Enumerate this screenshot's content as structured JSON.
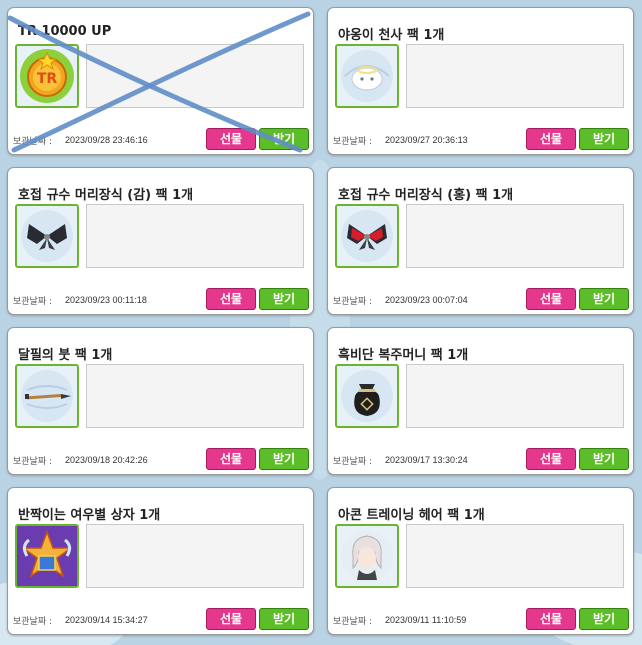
{
  "labels": {
    "storage_date": "보관날짜 :",
    "gift_button": "선물",
    "receive_button": "받기"
  },
  "colors": {
    "gift": "#e4388e",
    "receive": "#5bbd27",
    "frame": "#6bb52e",
    "cross_mark": "#5f8dc6"
  },
  "items": [
    {
      "title": "TR 10000 UP",
      "date": "2023/09/28 23:46:16",
      "icon": "tr-coin-icon",
      "crossed_out": true
    },
    {
      "title": "야옹이 천사 팩 1개",
      "date": "2023/09/27 20:36:13",
      "icon": "angel-cat-pack-icon",
      "crossed_out": false
    },
    {
      "title": "호접 규수 머리장식 (감) 팩 1개",
      "date": "2023/09/23 00:11:18",
      "icon": "black-butterfly-icon",
      "crossed_out": false
    },
    {
      "title": "호접 규수 머리장식 (홍) 팩 1개",
      "date": "2023/09/23 00:07:04",
      "icon": "red-butterfly-icon",
      "crossed_out": false
    },
    {
      "title": "달필의 붓 팩 1개",
      "date": "2023/09/18 20:42:26",
      "icon": "brush-icon",
      "crossed_out": false
    },
    {
      "title": "흑비단 복주머니 팩 1개",
      "date": "2023/09/17 13:30:24",
      "icon": "lucky-pouch-icon",
      "crossed_out": false
    },
    {
      "title": "반짝이는 여우별 상자 1개",
      "date": "2023/09/14 15:34:27",
      "icon": "fox-star-box-icon",
      "crossed_out": false
    },
    {
      "title": "아콘 트레이닝 헤어 팩 1개",
      "date": "2023/09/11 11:10:59",
      "icon": "hair-pack-icon",
      "crossed_out": false
    }
  ]
}
